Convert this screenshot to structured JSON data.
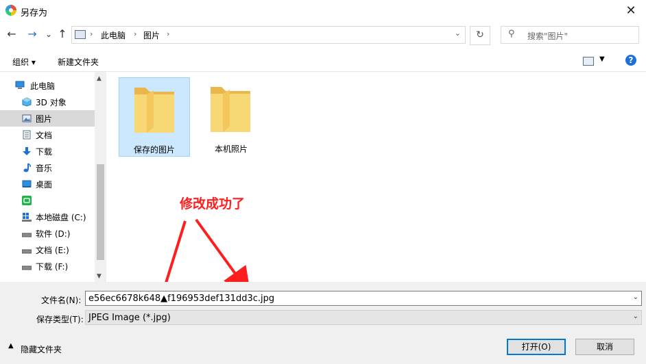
{
  "window": {
    "title": "另存为",
    "close": "✕"
  },
  "nav": {
    "back": "←",
    "forward": "→",
    "recent": "⌄",
    "up": "↑",
    "breadcrumb": [
      "此电脑",
      "图片"
    ],
    "sep": "›",
    "refresh": "↻",
    "search_placeholder": "搜索\"图片\""
  },
  "toolbar": {
    "organize": "组织 ▾",
    "new_folder": "新建文件夹",
    "help": "?"
  },
  "sidebar": {
    "items": [
      {
        "label": "此电脑",
        "icon": "computer-icon",
        "indent": 0
      },
      {
        "label": "3D 对象",
        "icon": "3d-objects-icon",
        "indent": 1
      },
      {
        "label": "图片",
        "icon": "pictures-icon",
        "indent": 1,
        "selected": true
      },
      {
        "label": "文档",
        "icon": "documents-icon",
        "indent": 1
      },
      {
        "label": "下载",
        "icon": "downloads-icon",
        "indent": 1
      },
      {
        "label": "音乐",
        "icon": "music-icon",
        "indent": 1
      },
      {
        "label": "桌面",
        "icon": "desktop-icon",
        "indent": 1
      },
      {
        "label": "",
        "icon": "green-app-icon",
        "indent": 1
      },
      {
        "label": "本地磁盘 (C:)",
        "icon": "drive-c-icon",
        "indent": 1
      },
      {
        "label": "软件 (D:)",
        "icon": "drive-icon",
        "indent": 1
      },
      {
        "label": "文档 (E:)",
        "icon": "drive-icon",
        "indent": 1
      },
      {
        "label": "下载 (F:)",
        "icon": "drive-icon",
        "indent": 1
      }
    ]
  },
  "folders": [
    {
      "label": "保存的图片",
      "selected": true
    },
    {
      "label": "本机照片",
      "selected": false
    }
  ],
  "annotation": "修改成功了",
  "form": {
    "filename_label": "文件名(N):",
    "filename_value": "e56ec6678k648▲f196953def131dd3c.jpg",
    "filetype_label": "保存类型(T):",
    "filetype_value": "JPEG Image (*.jpg)",
    "save": "打开(O)",
    "cancel": "取消",
    "hide_folders": "隐藏文件夹"
  },
  "colors": {
    "accent": "#0078d7",
    "annotation": "#ff1e1e",
    "selection": "#cce8ff"
  }
}
